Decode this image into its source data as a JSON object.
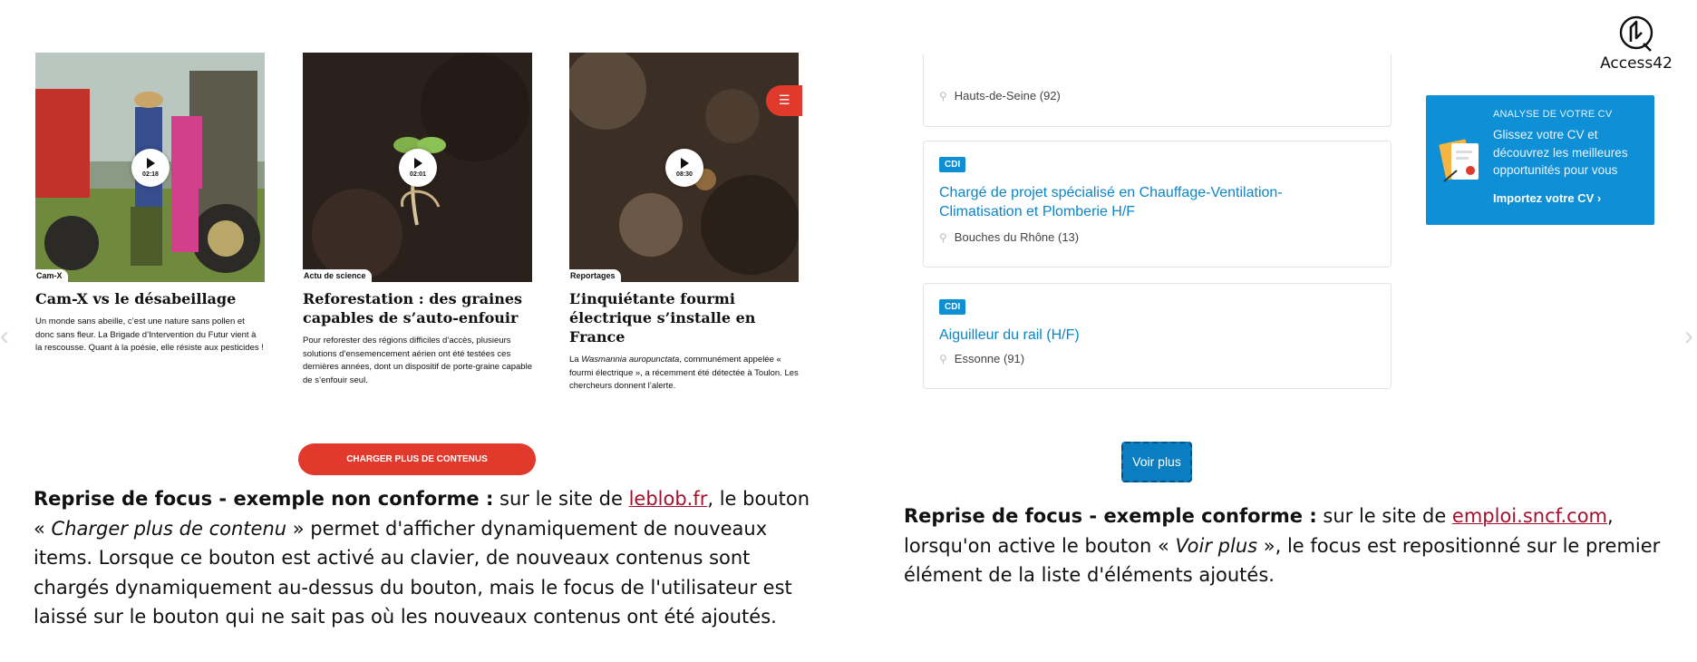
{
  "brand": {
    "name": "Access42"
  },
  "left_cards": [
    {
      "tag": "Cam-X",
      "duration": "02:18",
      "title": "Cam-X vs le désabeillage",
      "desc": "Un monde sans abeille, c’est une nature sans pollen et donc sans fleur. La Brigade d’Intervention du Futur vient à la rescousse. Quant à la poésie, elle résiste aux pesticides !"
    },
    {
      "tag": "Actu de science",
      "duration": "02:01",
      "title": "Reforestation : des graines capables de s’auto-enfouir",
      "desc": "Pour reforester des régions difficiles d’accès, plusieurs solutions d’ensemencement aérien ont été testées ces dernières années, dont un dispositif de porte-graine capable de s’enfouir seul."
    },
    {
      "tag": "Reportages",
      "duration": "08:30",
      "title": "L’inquiétante fourmi électrique s’installe en France",
      "desc_before": "La ",
      "desc_italic": "Wasmannia auropunctata",
      "desc_after": ", communément appelée « fourmi électrique », a récemment été détectée à Toulon. Les chercheurs donnent l’alerte."
    }
  ],
  "load_more_label": "CHARGER PLUS DE CONTENUS",
  "left_explain": {
    "bold": "Reprise de focus - exemple non conforme :",
    "t1": " sur le site de ",
    "link": "leblob.fr",
    "t2": ", le bouton « ",
    "italic": "Charger plus de contenu",
    "t3": " » permet d'afficher dynamiquement de nouveaux items. Lorsque ce bouton est activé au clavier, de nouveaux contenus sont chargés dynamiquement au-dessus du bouton, mais le focus de l'utilisateur est laissé sur le bouton qui ne sait pas où les nouveaux contenus ont été ajoutés."
  },
  "jobs": [
    {
      "location": "Hauts-de-Seine (92)"
    },
    {
      "badge": "CDI",
      "title": "Chargé de projet spécialisé en Chauffage-Ventilation-Climatisation et Plomberie H/F",
      "location": "Bouches du Rhône (13)"
    },
    {
      "badge": "CDI",
      "title": "Aiguilleur du rail (H/F)",
      "location": "Essonne (91)"
    }
  ],
  "cv_box": {
    "kicker": "ANALYSE DE VOTRE CV",
    "text": "Glissez votre CV et découvrez les meilleures opportunités pour vous",
    "link": "Importez votre CV"
  },
  "voir_plus_label": "Voir plus",
  "right_explain": {
    "bold": "Reprise de focus - exemple conforme :",
    "t1": " sur le site de ",
    "link": "emploi.sncf.com",
    "t2": ", lorsqu'on active le bouton « ",
    "italic": "Voir plus",
    "t3": " », le focus est repositionné sur le premier élément de la liste d'éléments ajoutés."
  },
  "colors": {
    "red_accent": "#e2392d",
    "blue_accent": "#0f8fd5",
    "link_red": "#a3122c"
  },
  "icons": [
    "play-icon",
    "search-list-icon",
    "pin-icon",
    "cv-document-icon",
    "chevron-right-icon",
    "chevron-left-icon",
    "logo-icon"
  ]
}
